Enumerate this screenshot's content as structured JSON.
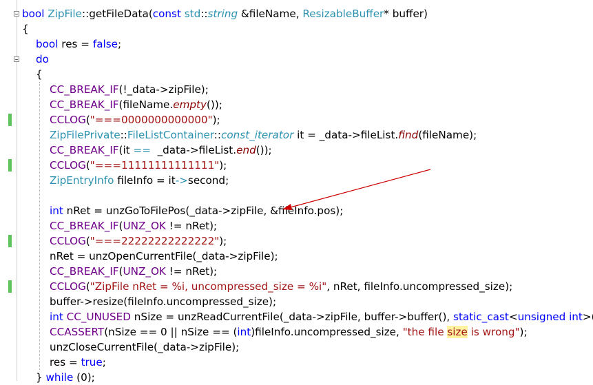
{
  "lines": [
    {
      "indent": 0,
      "segments": [
        {
          "t": "bool",
          "c": "kw"
        },
        {
          "t": " ",
          "c": "plain"
        },
        {
          "t": "ZipFile",
          "c": "ty"
        },
        {
          "t": "::",
          "c": "plain"
        },
        {
          "t": "getFileData",
          "c": "fn"
        },
        {
          "t": "(",
          "c": "plain"
        },
        {
          "t": "const",
          "c": "kw"
        },
        {
          "t": " ",
          "c": "plain"
        },
        {
          "t": "std",
          "c": "ty"
        },
        {
          "t": "::",
          "c": "plain"
        },
        {
          "t": "string",
          "c": "ty-it"
        },
        {
          "t": " &fileName, ",
          "c": "plain"
        },
        {
          "t": "ResizableBuffer",
          "c": "ty"
        },
        {
          "t": "* buffer)",
          "c": "plain"
        }
      ]
    },
    {
      "indent": 0,
      "segments": [
        {
          "t": "{",
          "c": "plain"
        }
      ]
    },
    {
      "indent": 1,
      "segments": [
        {
          "t": "bool",
          "c": "kw"
        },
        {
          "t": " res = ",
          "c": "plain"
        },
        {
          "t": "false",
          "c": "kw"
        },
        {
          "t": ";",
          "c": "plain"
        }
      ]
    },
    {
      "indent": 1,
      "segments": [
        {
          "t": "do",
          "c": "kw"
        }
      ]
    },
    {
      "indent": 1,
      "segments": [
        {
          "t": "{",
          "c": "plain"
        }
      ]
    },
    {
      "indent": 2,
      "segments": [
        {
          "t": "CC_BREAK_IF",
          "c": "mac"
        },
        {
          "t": "(!_data->zipFile);",
          "c": "plain"
        }
      ]
    },
    {
      "indent": 2,
      "segments": [
        {
          "t": "CC_BREAK_IF",
          "c": "mac"
        },
        {
          "t": "(fileName.",
          "c": "plain"
        },
        {
          "t": "empty",
          "c": "it"
        },
        {
          "t": "());",
          "c": "plain"
        }
      ]
    },
    {
      "indent": 2,
      "segments": [
        {
          "t": "CCLOG",
          "c": "mac"
        },
        {
          "t": "(",
          "c": "plain"
        },
        {
          "t": "\"===0000000000000\"",
          "c": "str"
        },
        {
          "t": ");",
          "c": "plain"
        }
      ]
    },
    {
      "indent": 2,
      "segments": [
        {
          "t": "ZipFilePrivate",
          "c": "ty"
        },
        {
          "t": "::",
          "c": "plain"
        },
        {
          "t": "FileListContainer",
          "c": "ty"
        },
        {
          "t": "::",
          "c": "plain"
        },
        {
          "t": "const_iterator",
          "c": "ty-it"
        },
        {
          "t": " it = _data->fileList.",
          "c": "plain"
        },
        {
          "t": "find",
          "c": "it"
        },
        {
          "t": "(fileName);",
          "c": "plain"
        }
      ]
    },
    {
      "indent": 2,
      "segments": [
        {
          "t": "CC_BREAK_IF",
          "c": "mac"
        },
        {
          "t": "(it ",
          "c": "plain"
        },
        {
          "t": "==",
          "c": "ty"
        },
        {
          "t": "  _data->fileList.",
          "c": "plain"
        },
        {
          "t": "end",
          "c": "it"
        },
        {
          "t": "());",
          "c": "plain"
        }
      ]
    },
    {
      "indent": 2,
      "segments": [
        {
          "t": "CCLOG",
          "c": "mac"
        },
        {
          "t": "(",
          "c": "plain"
        },
        {
          "t": "\"===11111111111111\"",
          "c": "str"
        },
        {
          "t": ");",
          "c": "plain"
        }
      ]
    },
    {
      "indent": 2,
      "segments": [
        {
          "t": "ZipEntryInfo",
          "c": "ty"
        },
        {
          "t": " fileInfo = it",
          "c": "plain"
        },
        {
          "t": "->",
          "c": "ty"
        },
        {
          "t": "second;",
          "c": "plain"
        }
      ]
    },
    {
      "indent": 2,
      "segments": []
    },
    {
      "indent": 2,
      "segments": [
        {
          "t": "int",
          "c": "kw"
        },
        {
          "t": " nRet = unzGoToFilePos(_data->zipFile, &fileInfo.pos);",
          "c": "plain"
        }
      ]
    },
    {
      "indent": 2,
      "segments": [
        {
          "t": "CC_BREAK_IF",
          "c": "mac"
        },
        {
          "t": "(",
          "c": "plain"
        },
        {
          "t": "UNZ_OK",
          "c": "mac"
        },
        {
          "t": " != nRet);",
          "c": "plain"
        }
      ]
    },
    {
      "indent": 2,
      "segments": [
        {
          "t": "CCLOG",
          "c": "mac"
        },
        {
          "t": "(",
          "c": "plain"
        },
        {
          "t": "\"===22222222222222\"",
          "c": "str"
        },
        {
          "t": ");",
          "c": "plain"
        }
      ]
    },
    {
      "indent": 2,
      "segments": [
        {
          "t": "nRet = unzOpenCurrentFile(_data->zipFile);",
          "c": "plain"
        }
      ]
    },
    {
      "indent": 2,
      "segments": [
        {
          "t": "CC_BREAK_IF",
          "c": "mac"
        },
        {
          "t": "(",
          "c": "plain"
        },
        {
          "t": "UNZ_OK",
          "c": "mac"
        },
        {
          "t": " != nRet);",
          "c": "plain"
        }
      ]
    },
    {
      "indent": 2,
      "segments": [
        {
          "t": "CCLOG",
          "c": "mac"
        },
        {
          "t": "(",
          "c": "plain"
        },
        {
          "t": "\"ZipFile nRet = %i, uncompressed_size = %i\"",
          "c": "str"
        },
        {
          "t": ", nRet, fileInfo.uncompressed_size);",
          "c": "plain"
        }
      ]
    },
    {
      "indent": 2,
      "segments": [
        {
          "t": "buffer->resize(fileInfo.uncompressed_size);",
          "c": "plain"
        }
      ]
    },
    {
      "indent": 2,
      "segments": [
        {
          "t": "int",
          "c": "kw"
        },
        {
          "t": " ",
          "c": "plain"
        },
        {
          "t": "CC_UNUSED",
          "c": "mac"
        },
        {
          "t": " nSize = unzReadCurrentFile(_data->zipFile, buffer->buffer(), ",
          "c": "plain"
        },
        {
          "t": "static_cast",
          "c": "kw"
        },
        {
          "t": "<",
          "c": "plain"
        },
        {
          "t": "unsigned",
          "c": "kw"
        },
        {
          "t": " ",
          "c": "plain"
        },
        {
          "t": "int",
          "c": "kw"
        },
        {
          "t": ">(",
          "c": "plain"
        }
      ]
    },
    {
      "indent": 2,
      "segments": [
        {
          "t": "CCASSERT",
          "c": "mac"
        },
        {
          "t": "(nSize == 0 || nSize == (",
          "c": "plain"
        },
        {
          "t": "int",
          "c": "kw"
        },
        {
          "t": ")fileInfo.uncompressed_size, ",
          "c": "plain"
        },
        {
          "t": "\"the file ",
          "c": "str"
        },
        {
          "t": "size",
          "c": "str-hl"
        },
        {
          "t": " is wrong\"",
          "c": "str"
        },
        {
          "t": ");",
          "c": "plain"
        }
      ]
    },
    {
      "indent": 2,
      "segments": [
        {
          "t": "unzCloseCurrentFile(_data->zipFile);",
          "c": "plain"
        }
      ]
    },
    {
      "indent": 2,
      "segments": [
        {
          "t": "res = ",
          "c": "plain"
        },
        {
          "t": "true",
          "c": "kw"
        },
        {
          "t": ";",
          "c": "plain"
        }
      ]
    },
    {
      "indent": 1,
      "segments": [
        {
          "t": "} ",
          "c": "plain"
        },
        {
          "t": "while",
          "c": "kw"
        },
        {
          "t": " (0);",
          "c": "plain"
        }
      ]
    }
  ],
  "changed_lines": [
    7,
    10,
    15,
    18
  ],
  "fold_lines": [
    0,
    3
  ],
  "colors": {
    "keyword": "#0000ff",
    "type": "#2b91af",
    "macro": "#6f008a",
    "string": "#a31515",
    "change_marker": "#5fc45f",
    "arrow": "#cc0000",
    "highlight": "#fff3a0"
  },
  "icons": {
    "fold": "collapse-box-icon",
    "arrow": "annotation-arrow-icon"
  }
}
